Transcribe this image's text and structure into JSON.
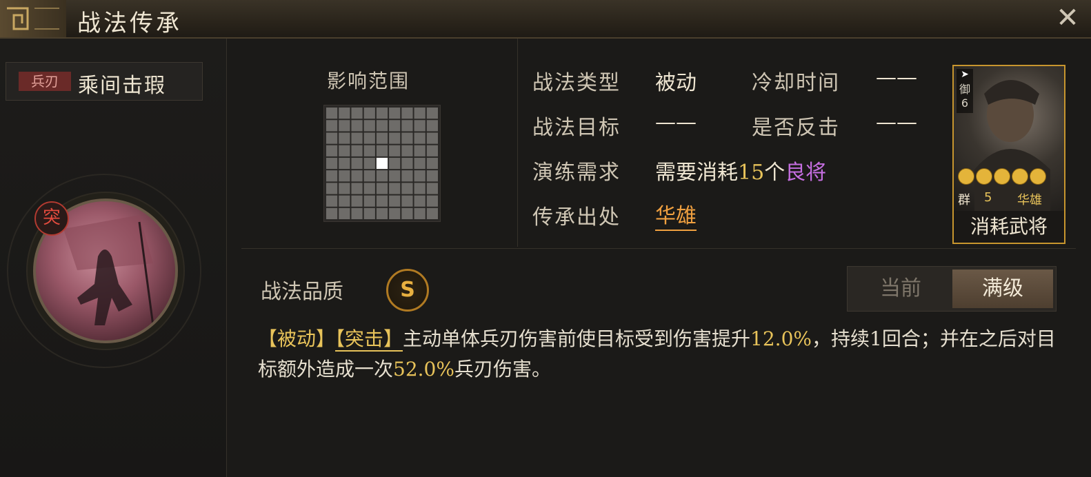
{
  "header": {
    "title": "战法传承",
    "close_icon": "close-icon"
  },
  "skill": {
    "type_tag": "兵刃",
    "name": "乘间击瑕",
    "assault_badge": "突",
    "quality_label": "战法品质",
    "quality_grade": "S"
  },
  "area": {
    "label": "影响范围",
    "grid_size": 9,
    "highlight_row": 4,
    "highlight_col": 4
  },
  "fields": {
    "type_label": "战法类型",
    "type_value": "被动",
    "cooldown_label": "冷却时间",
    "cooldown_value": "——",
    "target_label": "战法目标",
    "target_value": "——",
    "counter_label": "是否反击",
    "counter_value": "——",
    "train_label": "演练需求",
    "train_prefix": "需要消耗",
    "train_count": "15",
    "train_unit": "个",
    "train_item": "良将",
    "origin_label": "传承出处",
    "origin_value": "华雄"
  },
  "hero_card": {
    "troop_char": "御",
    "troop_level": "6",
    "faction": "群",
    "cost": "5",
    "name": "华雄",
    "stars": 5,
    "footer": "消耗武将"
  },
  "toggle": {
    "current_label": "当前",
    "max_label": "满级",
    "selected": "max"
  },
  "description": {
    "tag1": "【被动】",
    "tag2": "【突击】",
    "text1": "主动单体兵刃伤害前使目标受到伤害提升",
    "num1": "12.0%",
    "text2": "，持续1回合；并在之后对目标额外造成一次",
    "num2": "52.0%",
    "text3": "兵刃伤害。"
  },
  "colors": {
    "gold": "#e8c35a",
    "purple": "#c56ee0",
    "orange": "#f0a040",
    "damage_tag": "#6a2a28"
  }
}
